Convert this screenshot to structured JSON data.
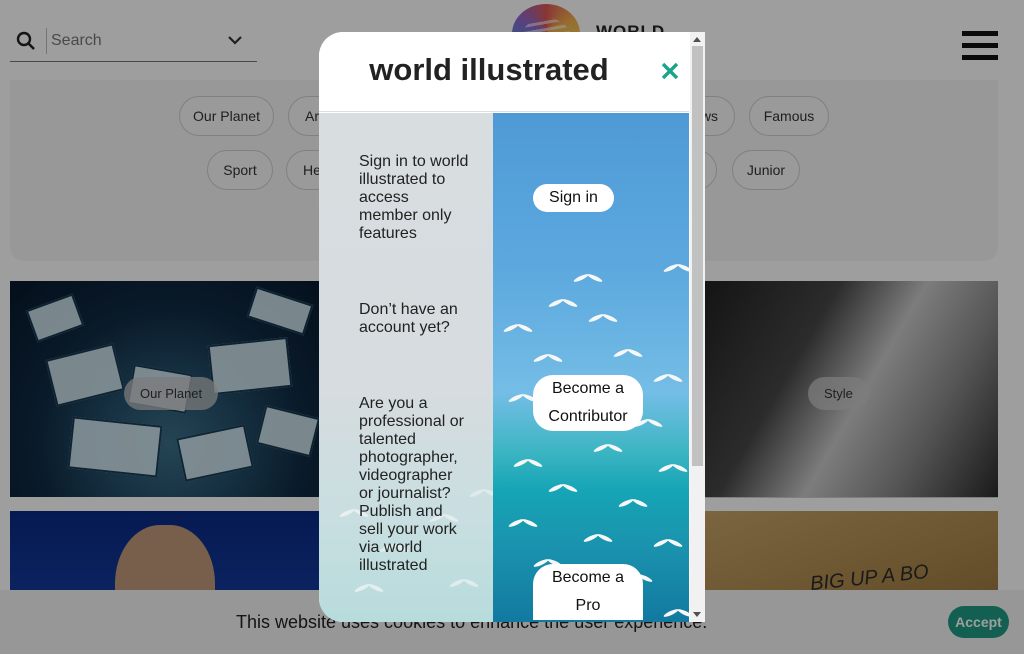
{
  "header": {
    "search_placeholder": "Search",
    "logo_text": "WORLD"
  },
  "categories": {
    "row1": [
      "Our Planet",
      "Ar",
      "ws",
      "Famous"
    ],
    "row2": [
      "Sport",
      "He",
      "",
      "Junior"
    ]
  },
  "cards": {
    "card1_label": "Our Planet",
    "card2_label": "Style",
    "card4_graffiti": "BIG UP A BO"
  },
  "cookie": {
    "message": "This website uses cookies to enhance the user experience.",
    "accept_label": "Accept"
  },
  "modal": {
    "title": "world illustrated",
    "signin_text": "Sign in to world illustrated to access member only features",
    "signin_button": "Sign in",
    "no_account_text": "Don’t have an account yet?",
    "contributor_button": "Become a Contributor",
    "pro_text": "Are you a professional or talented photographer, videographer or journalist? Publish and sell your work via world illustrated",
    "pro_button": "Become a Pro"
  },
  "colors": {
    "accent": "#1f9b85",
    "close": "#1aa58a"
  }
}
